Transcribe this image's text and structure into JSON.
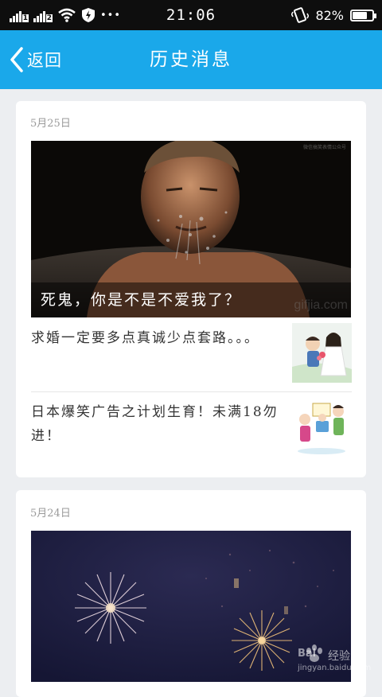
{
  "status_bar": {
    "time": "21:06",
    "sim1": "1",
    "sim2": "2",
    "battery_percent": "82%",
    "battery_level": 0.82,
    "more_dots": "•••"
  },
  "nav": {
    "back_label": "返回",
    "title": "历史消息"
  },
  "cards": [
    {
      "date": "5月25日",
      "hero_caption": "死鬼，你是不是不爱我了？",
      "hero_watermark": "gifjia.com",
      "hero_corner_mark": "微信搞笑表情公众号",
      "items": [
        {
          "text": "求婚一定要多点真诚少点套路。。。"
        },
        {
          "text": "日本爆笑广告之计划生育！未满18勿进！"
        }
      ]
    },
    {
      "date": "5月24日"
    }
  ],
  "watermark": {
    "brand": "Bai",
    "brand_cn": "经验",
    "url": "jingyan.baidu.com"
  },
  "colors": {
    "accent": "#1aa8ea",
    "status_bar": "#0e0e0e",
    "page_bg": "#eceef1"
  },
  "icons": {
    "back": "chevron-left-icon",
    "wifi": "wifi-icon",
    "shield": "shield-icon",
    "phone": "phone-vibrate-icon",
    "battery": "battery-icon"
  }
}
